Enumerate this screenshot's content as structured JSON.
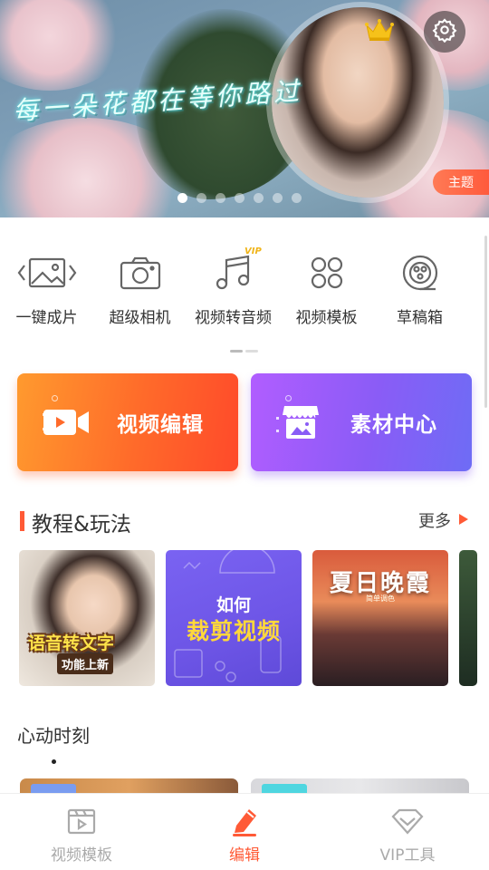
{
  "banner": {
    "caption": "每一朵花都在等你路过",
    "theme_tag": "主题",
    "slide_count": 7,
    "active_slide": 1
  },
  "tools": [
    {
      "label": "一键成片",
      "icon": "image-icon"
    },
    {
      "label": "超级相机",
      "icon": "camera-icon"
    },
    {
      "label": "视频转音频",
      "icon": "music-note-icon",
      "badge": "VIP"
    },
    {
      "label": "视频模板",
      "icon": "grid-template-icon"
    },
    {
      "label": "草稿箱",
      "icon": "draft-box-icon"
    }
  ],
  "cards": {
    "edit": "视频编辑",
    "material": "素材中心"
  },
  "tutorials": {
    "title": "教程&玩法",
    "more": "更多",
    "items": [
      {
        "line1": "语音转文字",
        "line2": "功能上新"
      },
      {
        "line1": "如何",
        "line2": "裁剪视频"
      },
      {
        "line1": "夏日晚霞",
        "line2": "简单调色"
      }
    ]
  },
  "moments": {
    "title": "心动时刻"
  },
  "nav": [
    {
      "label": "视频模板",
      "icon": "film-template-icon",
      "active": false
    },
    {
      "label": "编辑",
      "icon": "pencil-icon",
      "active": true
    },
    {
      "label": "VIP工具",
      "icon": "diamond-icon",
      "active": false
    }
  ],
  "colors": {
    "accent": "#ff5a36",
    "edit_card": "#ff6a2a",
    "material_card": "#8a5cf6",
    "vip": "#f0b418"
  }
}
